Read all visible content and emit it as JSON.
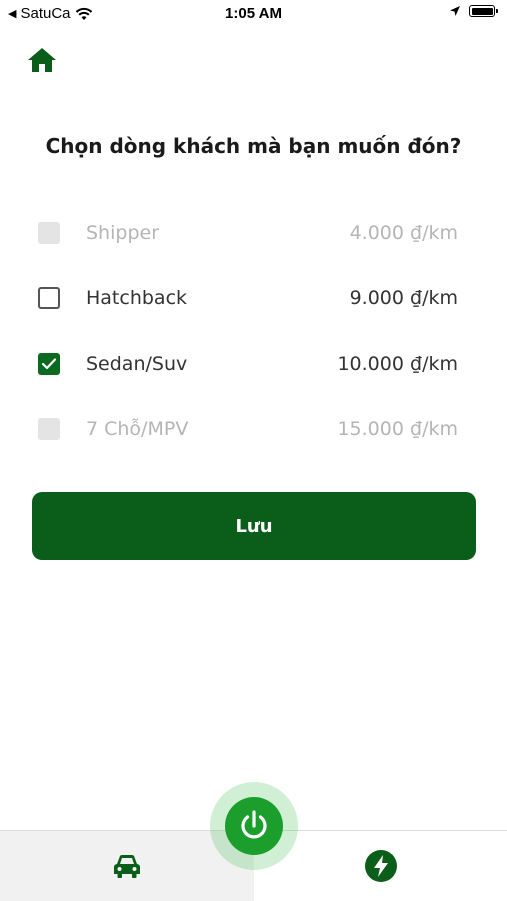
{
  "status_bar": {
    "carrier": "SatuCa",
    "time": "1:05 AM"
  },
  "header": {
    "home_icon": "home-icon"
  },
  "title": "Chọn dòng khách mà bạn muốn đón?",
  "options": [
    {
      "name": "Shipper",
      "price": "4.000 ₫/km",
      "state": "disabled"
    },
    {
      "name": "Hatchback",
      "price": "9.000 ₫/km",
      "state": "unchecked"
    },
    {
      "name": "Sedan/Suv",
      "price": "10.000 ₫/km",
      "state": "checked"
    },
    {
      "name": "7 Chỗ/MPV",
      "price": "15.000 ₫/km",
      "state": "disabled"
    }
  ],
  "save_label": "Lưu",
  "tab_bar": {
    "left_icon": "car-icon",
    "center_icon": "power-icon",
    "right_icon": "lightning-icon"
  },
  "colors": {
    "brand_green": "#0b5e1a",
    "power_green": "#1b9e2c",
    "disabled_text": "#b5b5b5"
  }
}
